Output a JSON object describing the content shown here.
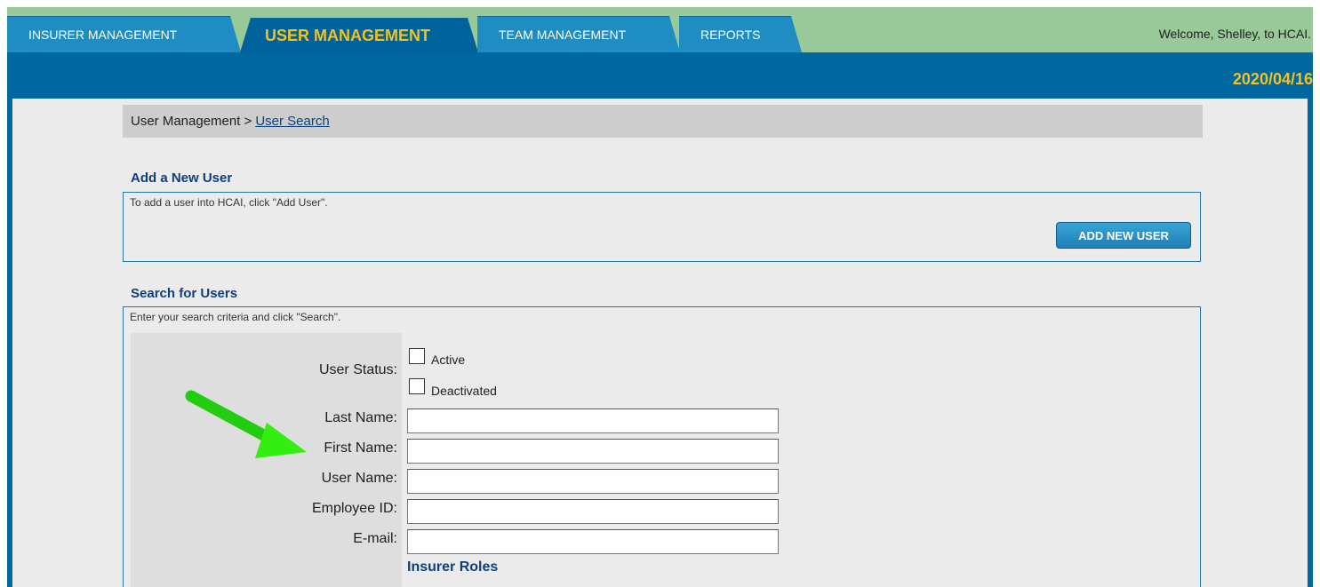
{
  "nav": {
    "tabs": [
      {
        "label": "INSURER MANAGEMENT"
      },
      {
        "label": "USER MANAGEMENT"
      },
      {
        "label": "TEAM MANAGEMENT"
      },
      {
        "label": "REPORTS"
      }
    ],
    "welcome": "Welcome, Shelley, to HCAI.",
    "date": "2020/04/16"
  },
  "breadcrumb": {
    "root": "User Management >",
    "current": "User Search"
  },
  "add_user": {
    "title": "Add a New User",
    "description": "To add a user into HCAI, click \"Add User\".",
    "button_label": "ADD NEW USER"
  },
  "search": {
    "title": "Search for Users",
    "description": "Enter your search criteria and click \"Search\".",
    "user_status_label": "User Status:",
    "status_options": [
      "Active",
      "Deactivated"
    ],
    "fields": [
      {
        "label": "Last Name:",
        "value": ""
      },
      {
        "label": "First Name:",
        "value": ""
      },
      {
        "label": "User Name:",
        "value": ""
      },
      {
        "label": "Employee ID:",
        "value": ""
      },
      {
        "label": "E-mail:",
        "value": ""
      }
    ],
    "insurer_roles_heading": "Insurer Roles"
  },
  "colors": {
    "nav_green": "#99c999",
    "tab_blue": "#1f8dc2",
    "active_tab_blue": "#00629b",
    "accent_gold": "#f4c21a",
    "heading_navy": "#0d3f7f",
    "annotation_arrow": "#33ee11"
  },
  "icons": {
    "annotation": "green-arrow-icon"
  }
}
